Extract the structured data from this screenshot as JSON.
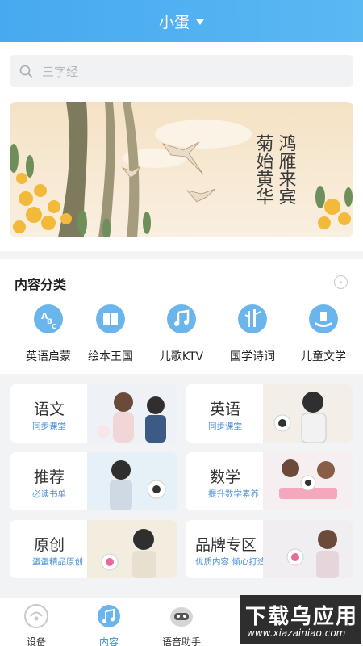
{
  "header": {
    "title": "小蛋"
  },
  "search": {
    "placeholder": "三字经"
  },
  "banner": {
    "poem_col1": "鸿雁来宾",
    "poem_col2": "菊始黄华"
  },
  "categories": {
    "title": "内容分类",
    "items": [
      {
        "label": "英语启蒙",
        "icon": "abc-icon"
      },
      {
        "label": "绘本王国",
        "icon": "book-icon"
      },
      {
        "label": "儿歌KTV",
        "icon": "music-note-icon"
      },
      {
        "label": "国学诗词",
        "icon": "bamboo-icon"
      },
      {
        "label": "儿童文学",
        "icon": "literature-icon"
      }
    ]
  },
  "cards": [
    {
      "title": "语文",
      "sub": "同步课堂"
    },
    {
      "title": "英语",
      "sub": "同步课堂"
    },
    {
      "title": "推荐",
      "sub": "必读书单"
    },
    {
      "title": "数学",
      "sub": "提升数学素养"
    },
    {
      "title": "原创",
      "sub": "蛋蛋精品原创"
    },
    {
      "title": "品牌专区",
      "sub": "优质内容  倾心打造"
    }
  ],
  "tabbar": {
    "tabs": [
      {
        "label": "设备",
        "icon": "device-icon"
      },
      {
        "label": "内容",
        "icon": "music-note-icon",
        "active": true
      },
      {
        "label": "语音助手",
        "icon": "robot-icon"
      }
    ]
  },
  "watermark": {
    "big": "下载乌应用",
    "small": "www.xiazainiao.com"
  },
  "colors": {
    "accent": "#47a9ef",
    "link": "#4a90d8",
    "icon_fill": "#6ab6ec"
  }
}
